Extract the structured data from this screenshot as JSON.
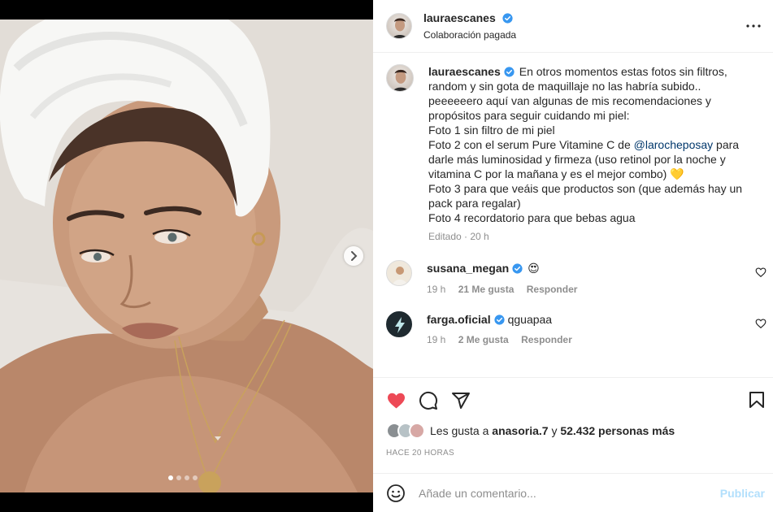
{
  "media": {
    "slide_count": 4,
    "active_slide": 1
  },
  "post": {
    "username": "lauraescanes",
    "subline": "Colaboración pagada",
    "verified": true
  },
  "caption": {
    "username": "lauraescanes",
    "lines": [
      "En otros momentos estas fotos sin filtros,",
      "random y sin gota de maquillaje no las habría subido..",
      "peeeeeero aquí van algunas de mis recomendaciones y",
      "propósitos para seguir cuidando mi piel:",
      "Foto 1 sin filtro de mi piel"
    ],
    "line6_pre": "Foto 2 con el serum Pure Vitamine C de ",
    "mention": "@larocheposay",
    "line6_post": " para",
    "lines_after": [
      "darle más luminosidad y firmeza (uso retinol por la noche y",
      "vitamina C por la mañana y es el mejor combo) 💛",
      "Foto 3 para que veáis que productos son (que además hay un",
      "pack para regalar)",
      "Foto 4 recordatorio para que bebas agua"
    ],
    "meta": "Editado · 20 h"
  },
  "comments": [
    {
      "username": "susana_megan",
      "text": "😍",
      "time": "19 h",
      "likes": "21 Me gusta",
      "reply": "Responder"
    },
    {
      "username": "farga.oficial",
      "text": "qguapaa",
      "time": "19 h",
      "likes": "2 Me gusta",
      "reply": "Responder"
    }
  ],
  "likes": {
    "prefix": "Les gusta a",
    "user": "anasoria.7",
    "join": "y",
    "count": "52.432 personas más"
  },
  "timeago": "HACE 20 HORAS",
  "add_comment": {
    "placeholder": "Añade un comentario...",
    "publish": "Publicar"
  },
  "colors": {
    "like_active": "#ed4956",
    "verified": "#3897f0",
    "mention": "#00376b",
    "publish_disabled": "#b2dffc"
  },
  "icons": [
    "next-arrow-icon",
    "verified-icon",
    "more-icon",
    "heart-icon",
    "comment-icon",
    "share-icon",
    "bookmark-icon",
    "emoji-icon",
    "lightning-icon"
  ]
}
